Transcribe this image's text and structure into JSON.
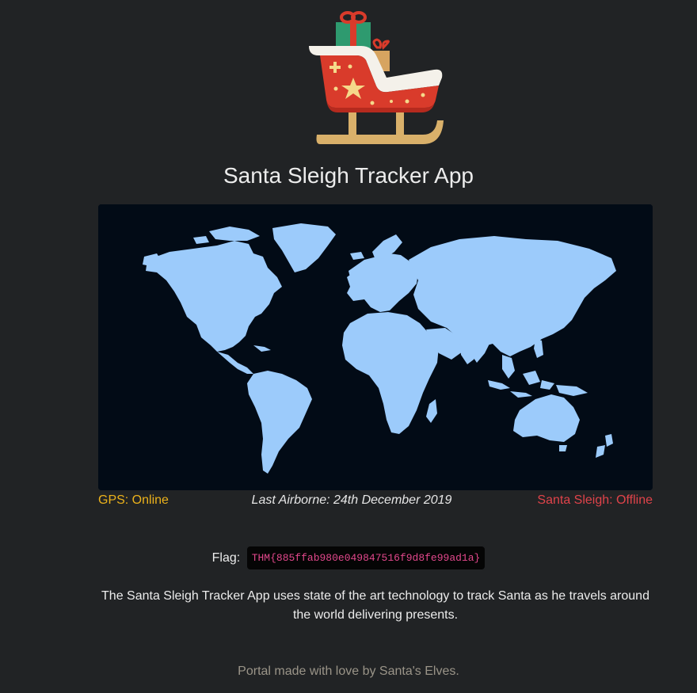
{
  "header": {
    "logo_icon": "santa-sleigh-icon",
    "title": "Santa Sleigh Tracker App"
  },
  "map": {
    "icon": "world-map",
    "land_color": "#9ccbfb",
    "ocean_color": "#020b16"
  },
  "status": {
    "gps": "GPS: Online",
    "last_airborne": "Last Airborne: 24th December 2019",
    "sleigh": "Santa Sleigh: Offline",
    "gps_color": "#ecb21b",
    "sleigh_color": "#e0434a"
  },
  "flag": {
    "label": "Flag:",
    "value": "THM{885ffab980e049847516f9d8fe99ad1a}"
  },
  "description": "The Santa Sleigh Tracker App uses state of the art technology to track Santa as he travels around the world delivering presents.",
  "footer": "Portal made with love by Santa's Elves."
}
